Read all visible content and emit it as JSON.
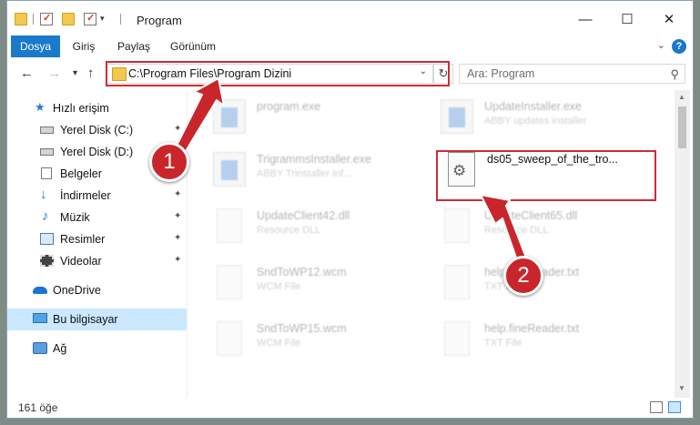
{
  "window": {
    "title": "Program",
    "controls": {
      "minimize": "—",
      "maximize": "☐",
      "close": "✕"
    }
  },
  "ribbon": {
    "tabs": [
      {
        "label": "Dosya",
        "active": true
      },
      {
        "label": "Giriş"
      },
      {
        "label": "Paylaş"
      },
      {
        "label": "Görünüm"
      }
    ],
    "help": "?"
  },
  "nav": {
    "back": "←",
    "forward": "→",
    "recent": "▾",
    "up": "↑",
    "address": "C:\\Program Files\\Program Dizini",
    "refresh": "↻",
    "search_placeholder": "Ara: Program"
  },
  "sidebar": {
    "items": [
      {
        "label": "Hızlı erişim",
        "icon": "star-icon"
      },
      {
        "label": "Yerel Disk (C:)",
        "icon": "drive-icon",
        "pinned": true
      },
      {
        "label": "Yerel Disk (D:)",
        "icon": "drive-icon",
        "pinned": true
      },
      {
        "label": "Belgeler",
        "icon": "documents-icon",
        "pinned": true
      },
      {
        "label": "İndirmeler",
        "icon": "download-icon",
        "pinned": true
      },
      {
        "label": "Müzik",
        "icon": "music-icon",
        "pinned": true
      },
      {
        "label": "Resimler",
        "icon": "pictures-icon",
        "pinned": true
      },
      {
        "label": "Videolar",
        "icon": "videos-icon",
        "pinned": true
      },
      {
        "label": "OneDrive",
        "icon": "cloud-icon"
      },
      {
        "label": "Bu bilgisayar",
        "icon": "computer-icon",
        "selected": true
      },
      {
        "label": "Ağ",
        "icon": "network-icon"
      }
    ]
  },
  "files": [
    {
      "name": "program.exe",
      "type": "",
      "icon": "exe-icon",
      "faded": true
    },
    {
      "name": "UpdateInstaller.exe",
      "type": "ABBY updates installer",
      "icon": "exe-icon",
      "faded": true
    },
    {
      "name": "TrigrammsInstaller.exe",
      "type": "ABBY Trinstaller Inf...",
      "icon": "exe-icon",
      "faded": true
    },
    {
      "name": "ds05_sweep_of_the_tro...",
      "type": "",
      "icon": "settings-file-icon",
      "faded": false
    },
    {
      "name": "UpdateClient42.dll",
      "type": "Resource DLL",
      "icon": "dll-icon",
      "faded": true
    },
    {
      "name": "UpdateClient65.dll",
      "type": "Resource DLL",
      "icon": "dll-icon",
      "faded": true
    },
    {
      "name": "SndToWP12.wcm",
      "type": "WCM File",
      "icon": "document-icon",
      "faded": true
    },
    {
      "name": "help.fineReader.txt",
      "type": "TXT File",
      "icon": "text-file-icon",
      "faded": true
    },
    {
      "name": "SndToWP15.wcm",
      "type": "WCM File",
      "icon": "document-icon",
      "faded": true
    },
    {
      "name": "help.fineReader.txt",
      "type": "TXT File",
      "icon": "text-file-icon",
      "faded": true
    }
  ],
  "status": {
    "count": "161 öğe"
  },
  "annotations": {
    "badges": [
      "1",
      "2"
    ],
    "color": "#c9262c"
  }
}
